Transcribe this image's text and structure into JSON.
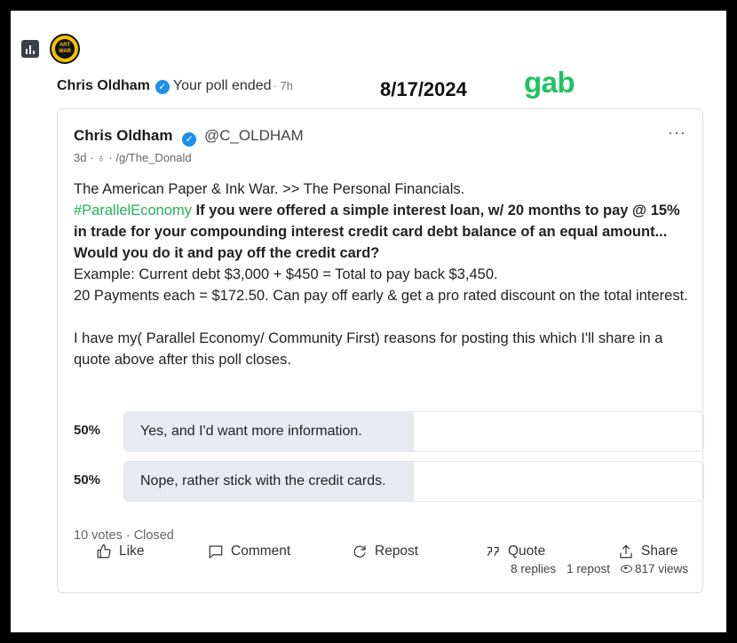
{
  "notification": {
    "name": "Chris Oldham",
    "text": "Your poll ended",
    "time": "· 7h",
    "avatar_text_1": "ART",
    "avatar_text_2": "WAR"
  },
  "overlay": {
    "date": "8/17/2024",
    "brand": "gab"
  },
  "post": {
    "author": "Chris Oldham",
    "handle": "@C_OLDHAM",
    "more": "···",
    "age": "3d ·",
    "group": "· /g/The_Donald",
    "line1": "The American Paper & Ink War. >> The Personal Financials.",
    "hashtag": "#ParallelEconomy",
    "bold_question": "If you were offered a simple interest loan, w/ 20 months to pay @ 15% in trade for your compounding interest credit card debt balance of an equal amount... Would you do it and pay off the credit card?",
    "example": "Example: Current debt $3,000 + $450 = Total to pay back $3,450.",
    "payments": "20 Payments each = $172.50. Can pay off early & get a pro rated discount on the total interest.",
    "reason": "I have my( Parallel Economy/ Community First) reasons for posting this which I'll share in a quote above after this poll closes."
  },
  "poll": {
    "options": [
      {
        "percent_label": "50%",
        "percent": 50,
        "label": "Yes, and I'd want more information."
      },
      {
        "percent_label": "50%",
        "percent": 50,
        "label": "Nope, rather stick with the credit cards."
      }
    ],
    "summary": "10 votes · Closed"
  },
  "stats": {
    "replies": "8 replies",
    "reposts": "1 repost",
    "views": "817 views"
  },
  "actions": {
    "like": "Like",
    "comment": "Comment",
    "repost": "Repost",
    "quote": "Quote",
    "share": "Share"
  },
  "colors": {
    "verified": "#1d8eea",
    "hashtag": "#21b35a",
    "brand": "#21c25f",
    "poll_fill": "#e7eaee"
  }
}
